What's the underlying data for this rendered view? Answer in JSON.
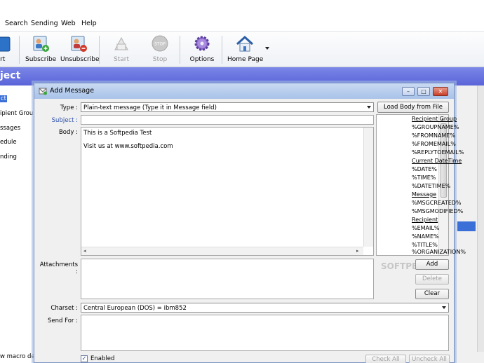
{
  "menu": [
    "Search",
    "Sending",
    "Web",
    "Help"
  ],
  "toolbar": {
    "buttons": [
      {
        "label": "ort",
        "icon": "export-icon"
      },
      {
        "label": "Subscribe",
        "icon": "subscribe-icon"
      },
      {
        "label": "Unsubscribe",
        "icon": "unsubscribe-icon"
      },
      {
        "label": "Start",
        "icon": "start-icon"
      },
      {
        "label": "Stop",
        "icon": "stop-icon"
      },
      {
        "label": "Options",
        "icon": "gear-icon"
      },
      {
        "label": "Home Page",
        "icon": "home-icon"
      }
    ]
  },
  "banner": {
    "title": "ject"
  },
  "left_panel": {
    "items": [
      "ct",
      "ipient Groups",
      "ssages",
      "edule",
      "nding"
    ],
    "status": "w macro de"
  },
  "dialog": {
    "title": "Add Message",
    "window_buttons": [
      "minimize",
      "maximize",
      "close"
    ],
    "type_label": "Type :",
    "type_value": "Plain-text message (Type it in Message field)",
    "load_body_button": "Load Body from File",
    "subject_label": "Subject :",
    "subject_value": "",
    "body_label": "Body :",
    "body_lines": [
      "This is a Softpedia Test",
      "",
      "Visit us at www.softpedia.com"
    ],
    "macros": [
      {
        "text": "Recipient Group",
        "head": true
      },
      {
        "text": "%GROUPNAME%",
        "head": false
      },
      {
        "text": "%FROMNAME%",
        "head": false
      },
      {
        "text": "%FROMEMAIL%",
        "head": false
      },
      {
        "text": "%REPLYTOEMAIL%",
        "head": false
      },
      {
        "text": "Current DateTime",
        "head": true
      },
      {
        "text": "%DATE%",
        "head": false
      },
      {
        "text": "%TIME%",
        "head": false
      },
      {
        "text": "%DATETIME%",
        "head": false
      },
      {
        "text": "Message",
        "head": true
      },
      {
        "text": "%MSGCREATED%",
        "head": false
      },
      {
        "text": "%MSGMODIFIED%",
        "head": false
      },
      {
        "text": "Recipient",
        "head": true
      },
      {
        "text": "%EMAIL%",
        "head": false
      },
      {
        "text": "%NAME%",
        "head": false
      },
      {
        "text": "%TITLE%",
        "head": false
      },
      {
        "text": "%ORGANIZATION%",
        "head": false
      }
    ],
    "attachments_label": "Attachments :",
    "add_button": "Add",
    "delete_button": "Delete",
    "clear_button": "Clear",
    "charset_label": "Charset :",
    "charset_value": "Central European (DOS) = ibm852",
    "send_for_label": "Send For :",
    "enabled_label": "Enabled",
    "enabled_checked": true,
    "check_all_button": "Check All",
    "uncheck_all_button": "Uncheck All",
    "watermark": "SOFTPEDIA"
  },
  "colors": {
    "banner": "#5a64d8",
    "selection": "#3b6fd8",
    "subject_label": "#2a4ea8"
  }
}
